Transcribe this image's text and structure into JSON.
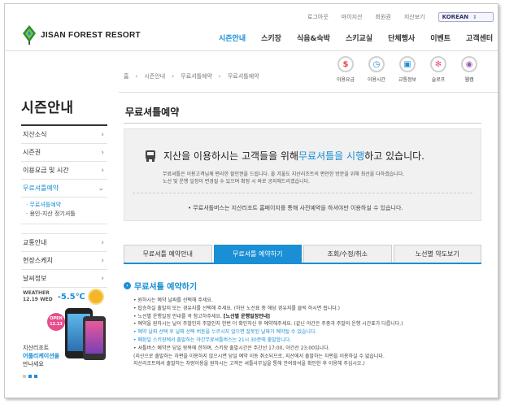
{
  "util": {
    "links": [
      "로그아웃",
      "마이지산",
      "회원권",
      "지산보기"
    ],
    "language": "KOREAN"
  },
  "logo": {
    "name": "JISAN FOREST RESORT"
  },
  "gnb": {
    "items": [
      "시즌안내",
      "스키장",
      "식음&숙박",
      "스키교실",
      "단체행사",
      "이벤트",
      "고객센터"
    ],
    "active": "시즌안내"
  },
  "side": {
    "title": "시즌안내",
    "items": [
      "지산소식",
      "시즌권",
      "이용요금 및 시간",
      "무료셔틀예약"
    ],
    "sub": [
      "· 무료셔틀예약",
      "· 용인-지산 정기셔틀"
    ],
    "items2": [
      "교통안내",
      "현장스케치",
      "날씨정보"
    ]
  },
  "weather": {
    "label1": "WEATHER",
    "label2": "12.19 WED",
    "temp": "-5.5℃",
    "promo_line1": "지산리조트",
    "promo_line2": "어플리케이션을",
    "promo_line3": "만나세요",
    "badge": "OPEN 12.13"
  },
  "breadcrumb": [
    "홈",
    "시즌안내",
    "무료셔틀예약",
    "무료셔틀예약"
  ],
  "quick": [
    {
      "label": "이용요금",
      "icon": "won-icon"
    },
    {
      "label": "이용시간",
      "icon": "clock-icon"
    },
    {
      "label": "교통정보",
      "icon": "bus-icon"
    },
    {
      "label": "슬로프",
      "icon": "snowflake-icon"
    },
    {
      "label": "웹캠",
      "icon": "webcam-icon"
    }
  ],
  "content": {
    "title": "무료셔틀예약",
    "headline_pre": "지산을 이용하시는 고객들을 위해 ",
    "headline_hl": "무료셔틀을 시행",
    "headline_post": "하고 있습니다.",
    "small1": "무료셔틀은 이용고객님께 편리한 할인권을 드립니다. 올 겨울도 지산리조트의 편안한 방문을 위해 최선을 다하겠습니다.",
    "small2": "노선 및 운행 일정이 변경될 수 있으며 확정 시 바로 공지해드리겠습니다.",
    "note": "• 무료셔틀버스는 지산리조트 홈페이지를 통해 사전예약을 하셔야만 이용하실 수 있습니다."
  },
  "tabs": [
    "무료셔틀 예약안내",
    "무료셔틀 예약하기",
    "조회/수정/취소",
    "노선별 약도보기"
  ],
  "active_tab": 1,
  "section": {
    "title": "무료셔틀 예약하기",
    "lines": [
      "• 원하시는 예약 날짜를 선택해 주세요.",
      "• 탑승하실 출발지 또는 경유지를 선택해 주세요. (하단 노선표 중 해당 경유지를 클릭 하시면 됩니다.)",
      "• 노선별 운행일정 안내를 꼭 참고하주세요. ",
      "• 예약을 원하시는 날이 주말인지 주말인지 한번 더 확인하신 후 예약해주세요. (같닌 야간은 주중과 주말의 운행 시간표가 다릅니다.)",
      "• 예약 날짜 선택 후 날짜 선택 버튼을 누르시지 않으면 잘못된 날짜가 예약될 수 있습니다.",
      "• 폐장일 스키장에서 출발하는 야간무료셔틀버스는 21시 30분에 출발합니다.",
      "• 셔틀버스 예약은 당일 왕복에 한하며, 스키장 출발시간은 주간선 17:00, 야간선 23:00입니다.",
      "  (지산으로 출발하는 차편을 이용하지 않으시면 당일 예약 이동 취소되므로, 지산에서 출발하는 차편을 이용하실 수 없습니다.",
      "  지산리조트에서 출발하는 차량이용을 원하시는 고객은 셔틀사무실을 통해 잔여좌석을 확인한 후 이용해 주십시오.)"
    ],
    "bold_suffix": "[노선별 운행일정안내]"
  }
}
